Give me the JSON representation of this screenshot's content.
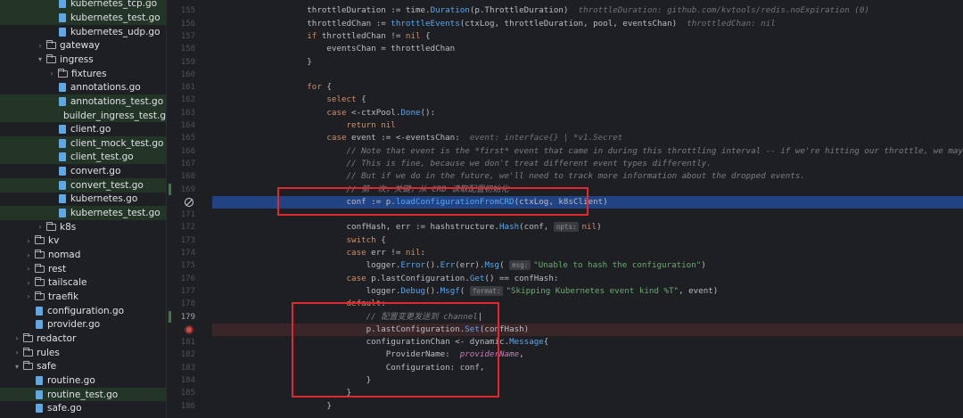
{
  "project_tree": [
    {
      "label": "kubernetes_tcp.go",
      "kind": "file",
      "indent": 4,
      "test": true
    },
    {
      "label": "kubernetes_test.go",
      "kind": "file",
      "indent": 4,
      "test": true
    },
    {
      "label": "kubernetes_udp.go",
      "kind": "file",
      "indent": 4,
      "test": false
    },
    {
      "label": "gateway",
      "kind": "folder",
      "indent": 3,
      "open": false
    },
    {
      "label": "ingress",
      "kind": "folder",
      "indent": 3,
      "open": true
    },
    {
      "label": "fixtures",
      "kind": "folder",
      "indent": 4,
      "open": false
    },
    {
      "label": "annotations.go",
      "kind": "file",
      "indent": 4,
      "test": false
    },
    {
      "label": "annotations_test.go",
      "kind": "file",
      "indent": 4,
      "test": true
    },
    {
      "label": "builder_ingress_test.g",
      "kind": "file",
      "indent": 4,
      "test": true
    },
    {
      "label": "client.go",
      "kind": "file",
      "indent": 4,
      "test": false
    },
    {
      "label": "client_mock_test.go",
      "kind": "file",
      "indent": 4,
      "test": true
    },
    {
      "label": "client_test.go",
      "kind": "file",
      "indent": 4,
      "test": true
    },
    {
      "label": "convert.go",
      "kind": "file",
      "indent": 4,
      "test": false
    },
    {
      "label": "convert_test.go",
      "kind": "file",
      "indent": 4,
      "test": true
    },
    {
      "label": "kubernetes.go",
      "kind": "file",
      "indent": 4,
      "test": false
    },
    {
      "label": "kubernetes_test.go",
      "kind": "file",
      "indent": 4,
      "test": true
    },
    {
      "label": "k8s",
      "kind": "folder",
      "indent": 3,
      "open": false
    },
    {
      "label": "kv",
      "kind": "folder",
      "indent": 2,
      "open": false
    },
    {
      "label": "nomad",
      "kind": "folder",
      "indent": 2,
      "open": false
    },
    {
      "label": "rest",
      "kind": "folder",
      "indent": 2,
      "open": false
    },
    {
      "label": "tailscale",
      "kind": "folder",
      "indent": 2,
      "open": false
    },
    {
      "label": "traefik",
      "kind": "folder",
      "indent": 2,
      "open": false
    },
    {
      "label": "configuration.go",
      "kind": "file",
      "indent": 2,
      "test": false
    },
    {
      "label": "provider.go",
      "kind": "file",
      "indent": 2,
      "test": false
    },
    {
      "label": "redactor",
      "kind": "folder",
      "indent": 1,
      "open": false
    },
    {
      "label": "rules",
      "kind": "folder",
      "indent": 1,
      "open": false
    },
    {
      "label": "safe",
      "kind": "folder",
      "indent": 1,
      "open": true
    },
    {
      "label": "routine.go",
      "kind": "file",
      "indent": 2,
      "test": false
    },
    {
      "label": "routine_test.go",
      "kind": "file",
      "indent": 2,
      "test": true
    },
    {
      "label": "safe.go",
      "kind": "file",
      "indent": 2,
      "test": false
    }
  ],
  "gutter": {
    "line_numbers": [
      "155",
      "156",
      "157",
      "158",
      "159",
      "160",
      "161",
      "162",
      "163",
      "164",
      "165",
      "166",
      "167",
      "168",
      "169",
      "170",
      "171",
      "172",
      "173",
      "174",
      "175",
      "176",
      "177",
      "178",
      "179",
      "180",
      "181",
      "182",
      "183",
      "184",
      "185",
      "186"
    ],
    "modified_lines": [
      "169",
      "179"
    ],
    "disabled_breakpoint_line": "170",
    "breakpoint_line": "180",
    "current_line": "179"
  },
  "code": [
    [
      [
        "tx",
        "        throttleDuration := "
      ],
      [
        "tx",
        "time."
      ],
      [
        "fn",
        "Duration"
      ],
      [
        "tx",
        "(p.ThrottleDuration)  "
      ],
      [
        "hint",
        "throttleDuration: github.com/kvtools/redis.noExpiration (0)"
      ]
    ],
    [
      [
        "tx",
        "        throttledChan := "
      ],
      [
        "fn",
        "throttleEvents"
      ],
      [
        "tx",
        "(ctxLog, throttleDuration, pool, eventsChan)  "
      ],
      [
        "hint",
        "throttledChan: nil"
      ]
    ],
    [
      [
        "kw",
        "        if"
      ],
      [
        "tx",
        " throttledChan != "
      ],
      [
        "kw",
        "nil"
      ],
      [
        "tx",
        " {"
      ]
    ],
    [
      [
        "tx",
        "            eventsChan = throttledChan"
      ]
    ],
    [
      [
        "tx",
        "        }"
      ]
    ],
    [
      [
        "tx",
        ""
      ]
    ],
    [
      [
        "kw",
        "        for"
      ],
      [
        "tx",
        " {"
      ]
    ],
    [
      [
        "kw",
        "            select"
      ],
      [
        "tx",
        " {"
      ]
    ],
    [
      [
        "kw",
        "            case"
      ],
      [
        "tx",
        " <-ctxPool."
      ],
      [
        "fn",
        "Done"
      ],
      [
        "tx",
        "():"
      ]
    ],
    [
      [
        "kw",
        "                return nil"
      ]
    ],
    [
      [
        "kw",
        "            case"
      ],
      [
        "tx",
        " event := <-eventsChan:  "
      ],
      [
        "hint",
        "event: interface{} | *v1.Secret"
      ]
    ],
    [
      [
        "cm",
        "                // Note that event is the *first* event that came in during this throttling interval -- if we're hitting our throttle, we may have dropped events."
      ]
    ],
    [
      [
        "cm",
        "                // This is fine, because we don't treat different event types differently."
      ]
    ],
    [
      [
        "cm",
        "                // But if we do in the future, we'll need to track more information about the dropped events."
      ]
    ],
    [
      [
        "cm",
        "                // 第一次，关键，从 CRD 读取配置初始化"
      ]
    ],
    [
      [
        "tx",
        "                conf := p."
      ],
      [
        "fn",
        "loadConfigurationFromCRD"
      ],
      [
        "tx",
        "(ctxLog, k8sClient)"
      ]
    ],
    [
      [
        "tx",
        ""
      ]
    ],
    [
      [
        "tx",
        "                confHash, err := "
      ],
      [
        "tx",
        "hashstructure."
      ],
      [
        "fn",
        "Hash"
      ],
      [
        "tx",
        "(conf, "
      ],
      [
        "ph",
        "opts:"
      ],
      [
        "kw",
        "nil"
      ],
      [
        "tx",
        ")"
      ]
    ],
    [
      [
        "kw",
        "                switch"
      ],
      [
        "tx",
        " {"
      ]
    ],
    [
      [
        "kw",
        "                case"
      ],
      [
        "tx",
        " err != "
      ],
      [
        "kw",
        "nil"
      ],
      [
        "tx",
        ":"
      ]
    ],
    [
      [
        "tx",
        "                    logger."
      ],
      [
        "fn",
        "Error"
      ],
      [
        "tx",
        "()."
      ],
      [
        "fn",
        "Err"
      ],
      [
        "tx",
        "(err)."
      ],
      [
        "fn",
        "Msg"
      ],
      [
        "tx",
        "( "
      ],
      [
        "ph",
        "msg:"
      ],
      [
        "str",
        "\"Unable to hash the configuration\""
      ],
      [
        "tx",
        ")"
      ]
    ],
    [
      [
        "kw",
        "                case"
      ],
      [
        "tx",
        " p.lastConfiguration."
      ],
      [
        "fn",
        "Get"
      ],
      [
        "tx",
        "() == confHash:"
      ]
    ],
    [
      [
        "tx",
        "                    logger."
      ],
      [
        "fn",
        "Debug"
      ],
      [
        "tx",
        "()."
      ],
      [
        "fn",
        "Msgf"
      ],
      [
        "tx",
        "( "
      ],
      [
        "ph",
        "format:"
      ],
      [
        "str",
        "\"Skipping Kubernetes event kind %T\""
      ],
      [
        "tx",
        ", event)"
      ]
    ],
    [
      [
        "kw",
        "                default"
      ],
      [
        "tx",
        ":"
      ]
    ],
    [
      [
        "cm",
        "                    // 配置变更发送到 channel"
      ],
      [
        "tx",
        "|"
      ]
    ],
    [
      [
        "tx",
        "                    p.lastConfiguration."
      ],
      [
        "fn",
        "Set"
      ],
      [
        "tx",
        "(confHash)"
      ]
    ],
    [
      [
        "tx",
        "                    configurationChan <- "
      ],
      [
        "tx",
        "dynamic."
      ],
      [
        "fn",
        "Message"
      ],
      [
        "tx",
        "{"
      ]
    ],
    [
      [
        "tx",
        "                        ProviderName:  "
      ],
      [
        "pm",
        "providerName"
      ],
      [
        "tx",
        ","
      ]
    ],
    [
      [
        "tx",
        "                        Configuration: conf,"
      ]
    ],
    [
      [
        "tx",
        "                    }"
      ]
    ],
    [
      [
        "tx",
        "                }"
      ]
    ],
    [
      [
        "tx",
        "            }"
      ]
    ]
  ],
  "highlights": {
    "exec_line_index": 15,
    "breakpoint_line_index": 25
  },
  "colors": {
    "editor_bg": "#1e1f22",
    "exec_line_bg": "#214283",
    "annotation_red": "#e4262f",
    "keyword": "#cf8e6d",
    "function": "#56a8f5",
    "string": "#6aab73",
    "comment": "#7a7e85"
  }
}
